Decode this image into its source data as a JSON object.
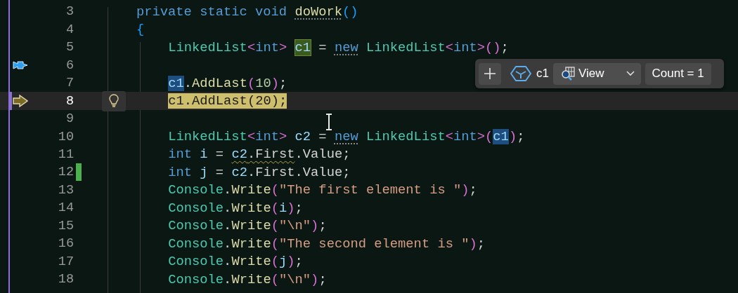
{
  "editor": {
    "lines": [
      {
        "number": "3",
        "current": false,
        "changed": false,
        "lightbulb": false,
        "pinned": false,
        "tokens": [
          {
            "text": "private static void ",
            "kind": "keyword"
          },
          {
            "text": "doWork",
            "kind": "method-dotted"
          },
          {
            "text": "()",
            "kind": "brace"
          }
        ]
      },
      {
        "number": "4",
        "current": false,
        "changed": false,
        "lightbulb": false,
        "pinned": false,
        "tokens": [
          {
            "text": "{",
            "kind": "brace"
          }
        ],
        "children": [
          {
            "number": "5",
            "current": false,
            "changed": false,
            "lightbulb": false,
            "pinned": false,
            "tokens": [
              {
                "text": "LinkedList",
                "kind": "type"
              },
              {
                "text": "<",
                "kind": "bracket"
              },
              {
                "text": "int",
                "kind": "keyword"
              },
              {
                "text": "> ",
                "kind": "bracket"
              },
              {
                "text": "c1",
                "kind": "ident-definition"
              },
              {
                "text": " = ",
                "kind": "plain"
              },
              {
                "text": "new",
                "kind": "keyword-dotted"
              },
              {
                "text": " LinkedList",
                "kind": "type"
              },
              {
                "text": "<",
                "kind": "bracket"
              },
              {
                "text": "int",
                "kind": "keyword"
              },
              {
                "text": ">()",
                "kind": "bracket"
              },
              {
                "text": ";",
                "kind": "plain"
              }
            ]
          },
          {
            "number": "6",
            "current": false,
            "changed": false,
            "lightbulb": false,
            "pinned": true
          },
          {
            "number": "7",
            "current": false,
            "changed": false,
            "lightbulb": false,
            "pinned": false,
            "tokens": [
              {
                "text": "c1",
                "kind": "ident-reference"
              },
              {
                "text": ".",
                "kind": "plain"
              },
              {
                "text": "AddLast",
                "kind": "method"
              },
              {
                "text": "(",
                "kind": "bracket"
              },
              {
                "text": "10",
                "kind": "number"
              },
              {
                "text": ")",
                "kind": "bracket"
              },
              {
                "text": ";",
                "kind": "plain"
              }
            ]
          },
          {
            "number": "8",
            "current": true,
            "changed": false,
            "lightbulb": true,
            "pinned": false,
            "tokens": [
              {
                "text": "c1.AddLast(20);",
                "kind": "statement"
              }
            ]
          },
          {
            "number": "9",
            "current": false,
            "changed": false,
            "lightbulb": false,
            "pinned": false
          },
          {
            "number": "10",
            "current": false,
            "changed": false,
            "lightbulb": false,
            "pinned": false,
            "tokens": [
              {
                "text": "LinkedList",
                "kind": "type"
              },
              {
                "text": "<",
                "kind": "bracket"
              },
              {
                "text": "int",
                "kind": "keyword"
              },
              {
                "text": "> ",
                "kind": "bracket"
              },
              {
                "text": "c2",
                "kind": "ident"
              },
              {
                "text": " = ",
                "kind": "plain"
              },
              {
                "text": "new",
                "kind": "keyword-dotted"
              },
              {
                "text": " LinkedList",
                "kind": "type"
              },
              {
                "text": "<",
                "kind": "bracket"
              },
              {
                "text": "int",
                "kind": "keyword"
              },
              {
                "text": ">(",
                "kind": "bracket"
              },
              {
                "text": "c1",
                "kind": "ident-reference"
              },
              {
                "text": ")",
                "kind": "bracket"
              },
              {
                "text": ";",
                "kind": "plain"
              }
            ]
          },
          {
            "number": "11",
            "current": false,
            "changed": false,
            "lightbulb": false,
            "pinned": false,
            "tokens": [
              {
                "text": "int ",
                "kind": "keyword"
              },
              {
                "text": "i",
                "kind": "ident"
              },
              {
                "text": " = ",
                "kind": "plain"
              },
              {
                "text": "c2",
                "kind": "ident-squiggle"
              },
              {
                "text": ".First",
                "kind": "plain-squiggle"
              },
              {
                "text": ".Value;",
                "kind": "plain"
              }
            ]
          },
          {
            "number": "12",
            "current": false,
            "changed": true,
            "lightbulb": false,
            "pinned": false,
            "tokens": [
              {
                "text": "int ",
                "kind": "keyword"
              },
              {
                "text": "j",
                "kind": "ident"
              },
              {
                "text": " = ",
                "kind": "plain"
              },
              {
                "text": "c2",
                "kind": "ident"
              },
              {
                "text": ".First.Value;",
                "kind": "plain"
              }
            ]
          },
          {
            "number": "13",
            "current": false,
            "changed": false,
            "lightbulb": false,
            "pinned": false,
            "tokens": [
              {
                "text": "Console",
                "kind": "type"
              },
              {
                "text": ".",
                "kind": "plain"
              },
              {
                "text": "Write",
                "kind": "method"
              },
              {
                "text": "(",
                "kind": "bracket"
              },
              {
                "text": "\"The first element is \"",
                "kind": "string"
              },
              {
                "text": ")",
                "kind": "bracket"
              },
              {
                "text": ";",
                "kind": "plain"
              }
            ]
          },
          {
            "number": "14",
            "current": false,
            "changed": false,
            "lightbulb": false,
            "pinned": false,
            "tokens": [
              {
                "text": "Console",
                "kind": "type"
              },
              {
                "text": ".",
                "kind": "plain"
              },
              {
                "text": "Write",
                "kind": "method"
              },
              {
                "text": "(",
                "kind": "bracket"
              },
              {
                "text": "i",
                "kind": "ident"
              },
              {
                "text": ")",
                "kind": "bracket"
              },
              {
                "text": ";",
                "kind": "plain"
              }
            ]
          },
          {
            "number": "15",
            "current": false,
            "changed": false,
            "lightbulb": false,
            "pinned": false,
            "tokens": [
              {
                "text": "Console",
                "kind": "type"
              },
              {
                "text": ".",
                "kind": "plain"
              },
              {
                "text": "Write",
                "kind": "method"
              },
              {
                "text": "(",
                "kind": "bracket"
              },
              {
                "text": "\"\\n\"",
                "kind": "string"
              },
              {
                "text": ")",
                "kind": "bracket"
              },
              {
                "text": ";",
                "kind": "plain"
              }
            ]
          },
          {
            "number": "16",
            "current": false,
            "changed": false,
            "lightbulb": false,
            "pinned": false,
            "tokens": [
              {
                "text": "Console",
                "kind": "type"
              },
              {
                "text": ".",
                "kind": "plain"
              },
              {
                "text": "Write",
                "kind": "method"
              },
              {
                "text": "(",
                "kind": "bracket"
              },
              {
                "text": "\"The second element is \"",
                "kind": "string"
              },
              {
                "text": ")",
                "kind": "bracket"
              },
              {
                "text": ";",
                "kind": "plain"
              }
            ]
          },
          {
            "number": "17",
            "current": false,
            "changed": false,
            "lightbulb": false,
            "pinned": false,
            "tokens": [
              {
                "text": "Console",
                "kind": "type"
              },
              {
                "text": ".",
                "kind": "plain"
              },
              {
                "text": "Write",
                "kind": "method"
              },
              {
                "text": "(",
                "kind": "bracket"
              },
              {
                "text": "j",
                "kind": "ident"
              },
              {
                "text": ")",
                "kind": "bracket"
              },
              {
                "text": ";",
                "kind": "plain"
              }
            ]
          },
          {
            "number": "18",
            "current": false,
            "changed": false,
            "lightbulb": false,
            "pinned": false,
            "tokens": [
              {
                "text": "Console",
                "kind": "type"
              },
              {
                "text": ".",
                "kind": "plain"
              },
              {
                "text": "Write",
                "kind": "method"
              },
              {
                "text": "(",
                "kind": "bracket"
              },
              {
                "text": "\"\\n\"",
                "kind": "string"
              },
              {
                "text": ")",
                "kind": "bracket"
              },
              {
                "text": ";",
                "kind": "plain"
              }
            ]
          }
        ]
      }
    ]
  },
  "datatip": {
    "expression": "c1",
    "view_button": "View",
    "value": "Count = 1"
  }
}
